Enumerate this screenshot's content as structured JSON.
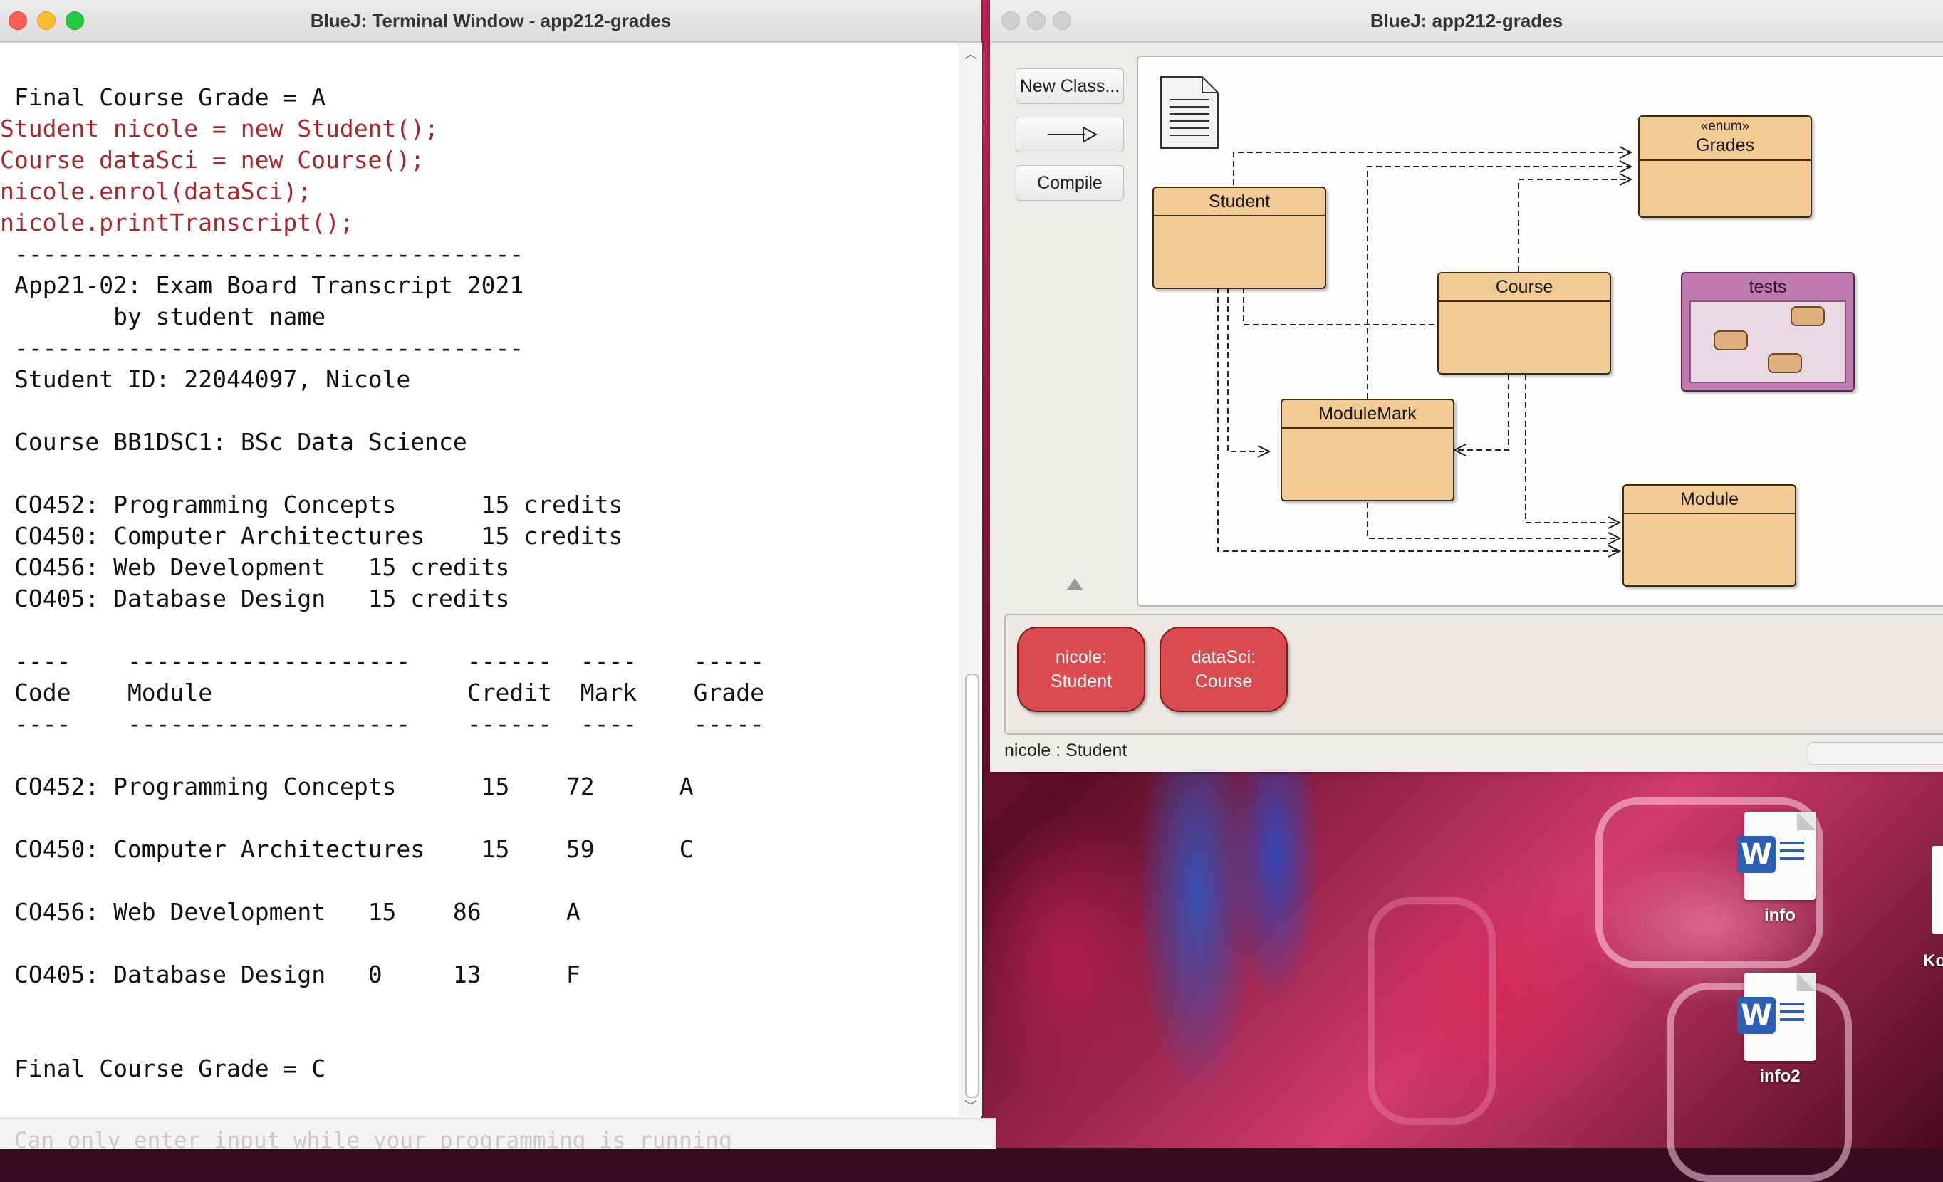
{
  "terminal": {
    "title": "BlueJ: Terminal Window - app212-grades",
    "lines": [
      {
        "text": "Final Course Grade = A",
        "kind": "out"
      },
      {
        "text": "Student nicole = new Student();",
        "kind": "cmd"
      },
      {
        "text": "Course dataSci = new Course();",
        "kind": "cmd"
      },
      {
        "text": "nicole.enrol(dataSci);",
        "kind": "cmd"
      },
      {
        "text": "nicole.printTranscript();",
        "kind": "cmd"
      },
      {
        "text": "------------------------------------",
        "kind": "out"
      },
      {
        "text": "App21-02: Exam Board Transcript 2021",
        "kind": "out"
      },
      {
        "text": "       by student name",
        "kind": "out"
      },
      {
        "text": "------------------------------------",
        "kind": "out"
      },
      {
        "text": "Student ID: 22044097, Nicole",
        "kind": "out"
      },
      {
        "text": "",
        "kind": "out"
      },
      {
        "text": "Course BB1DSC1: BSc Data Science",
        "kind": "out"
      },
      {
        "text": "",
        "kind": "out"
      },
      {
        "text": "CO452: Programming Concepts      15 credits",
        "kind": "out"
      },
      {
        "text": "CO450: Computer Architectures    15 credits",
        "kind": "out"
      },
      {
        "text": "CO456: Web Development   15 credits",
        "kind": "out"
      },
      {
        "text": "CO405: Database Design   15 credits",
        "kind": "out"
      },
      {
        "text": "",
        "kind": "out"
      },
      {
        "text": "----    --------------------    ------  ----    -----",
        "kind": "out"
      },
      {
        "text": "Code    Module                  Credit  Mark    Grade",
        "kind": "out"
      },
      {
        "text": "----    --------------------    ------  ----    -----",
        "kind": "out"
      },
      {
        "text": "",
        "kind": "out"
      },
      {
        "text": "CO452: Programming Concepts      15    72      A",
        "kind": "out"
      },
      {
        "text": "",
        "kind": "out"
      },
      {
        "text": "CO450: Computer Architectures    15    59      C",
        "kind": "out"
      },
      {
        "text": "",
        "kind": "out"
      },
      {
        "text": "CO456: Web Development   15    86      A",
        "kind": "out"
      },
      {
        "text": "",
        "kind": "out"
      },
      {
        "text": "CO405: Database Design   0     13      F",
        "kind": "out"
      },
      {
        "text": "",
        "kind": "out"
      },
      {
        "text": "",
        "kind": "out"
      },
      {
        "text": "Final Course Grade = C",
        "kind": "out"
      }
    ],
    "input_placeholder": "Can only enter input while your programming is running"
  },
  "bluej": {
    "title": "BlueJ:  app212-grades",
    "buttons": {
      "new_class": "New Class...",
      "compile": "Compile"
    },
    "classes": {
      "grades_stereotype": "«enum»",
      "grades": "Grades",
      "student": "Student",
      "course": "Course",
      "tests": "tests",
      "module_mark": "ModuleMark",
      "module": "Module"
    },
    "objects": [
      {
        "name": "nicole:",
        "type": "Student"
      },
      {
        "name": "dataSci:",
        "type": "Course"
      }
    ],
    "status": "nicole : Student"
  },
  "desktop": {
    "icons": [
      {
        "label": "info",
        "icon": "word-document-icon"
      },
      {
        "label": "info2",
        "icon": "word-document-icon"
      }
    ],
    "partial_label": "Ko"
  },
  "colors": {
    "class_fill": "#f2cb94",
    "package_fill": "#c27bb0",
    "object_fill": "#db4a4e",
    "command_text": "#a8262a"
  }
}
